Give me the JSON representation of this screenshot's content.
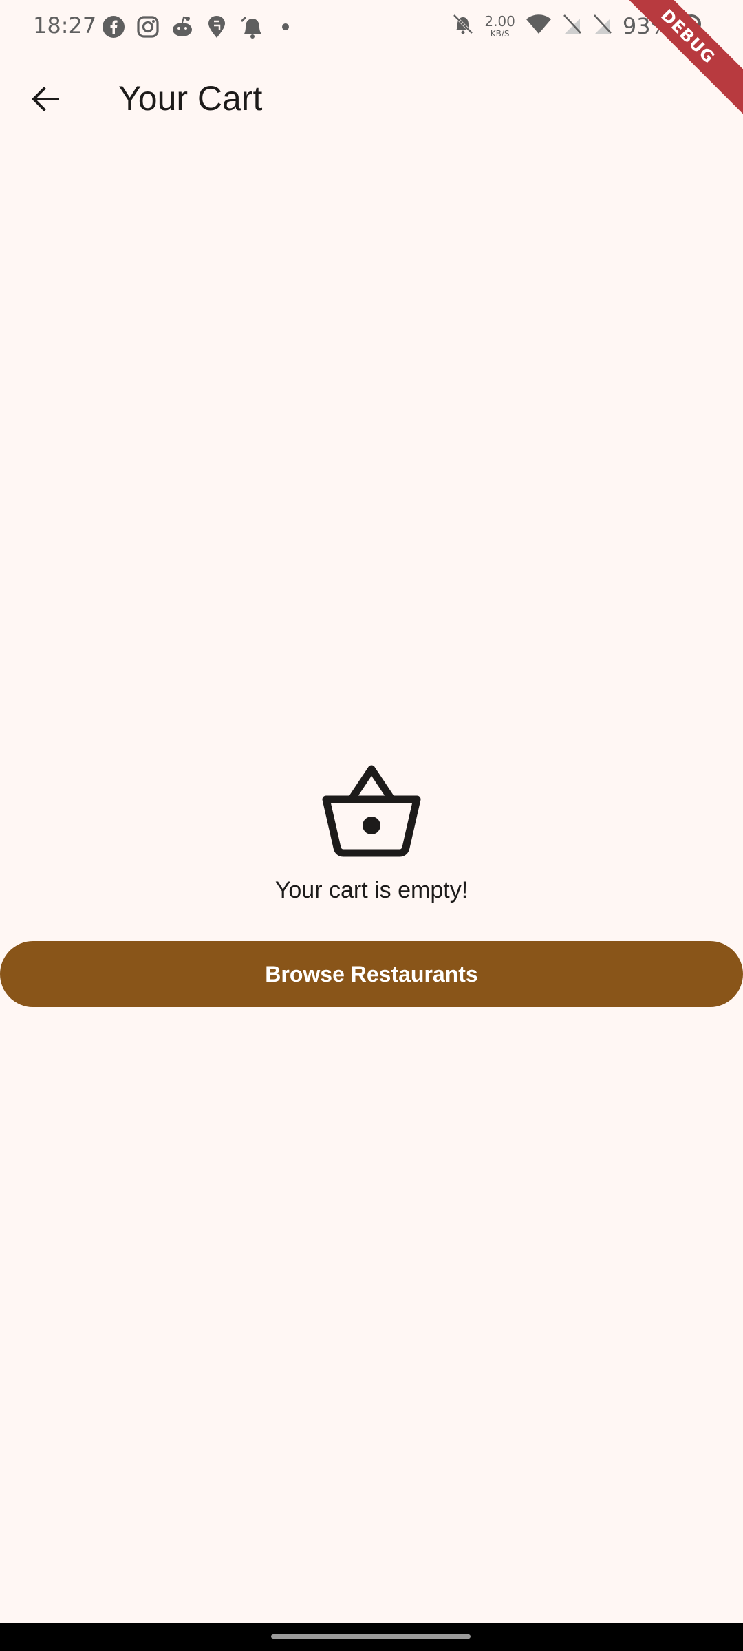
{
  "status_bar": {
    "time": "18:27",
    "net_speed_value": "2.00",
    "net_speed_unit": "KB/S",
    "battery": "93%",
    "left_icons": [
      "facebook-icon",
      "instagram-icon",
      "reddit-icon",
      "swiggy-icon",
      "notification-bell-icon",
      "more-dot-icon"
    ],
    "right_icons": [
      "mute-notifications-icon",
      "wifi-icon",
      "no-sim-icon",
      "no-sim-icon",
      "battery-icon"
    ]
  },
  "app_bar": {
    "title": "Your Cart",
    "back_icon": "arrow-back-icon"
  },
  "empty_state": {
    "icon": "shopping-basket-icon",
    "message": "Your cart is empty!",
    "button_label": "Browse Restaurants"
  },
  "debug_banner": {
    "label": "DEBUG"
  },
  "colors": {
    "background": "#FFF7F4",
    "primary_button": "#895519",
    "debug_banner": "#B83A3F",
    "text": "#1D1B1A",
    "status_icons": "#5F5F5F"
  }
}
